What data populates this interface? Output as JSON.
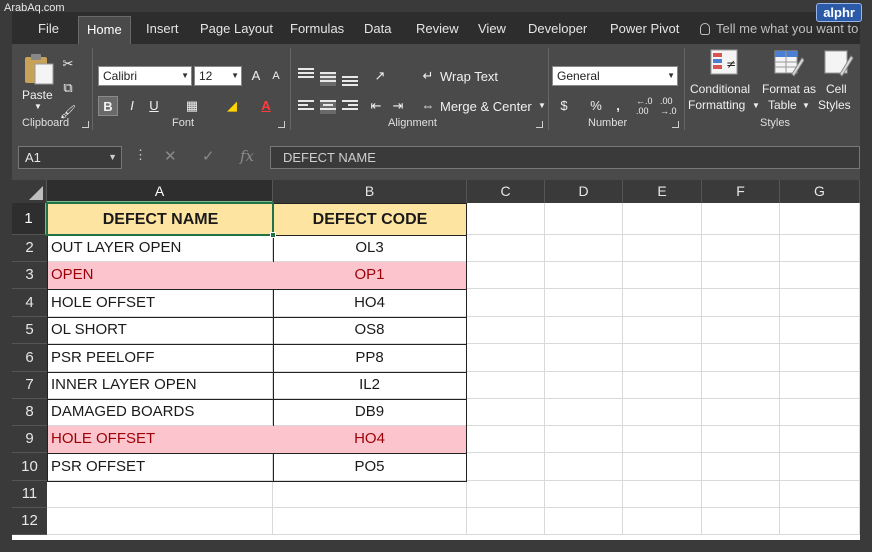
{
  "watermark": "ArabAq.com",
  "badge": "alphr",
  "tabs": [
    "File",
    "Home",
    "Insert",
    "Page Layout",
    "Formulas",
    "Data",
    "Review",
    "View",
    "Developer",
    "Power Pivot"
  ],
  "tell_me": "Tell me what you want to",
  "ribbon": {
    "clipboard": {
      "paste": "Paste",
      "label": "Clipboard"
    },
    "font": {
      "name": "Calibri",
      "size": "12",
      "grow": "A",
      "shrink": "A",
      "bold": "B",
      "italic": "I",
      "underline": "U",
      "label": "Font"
    },
    "alignment": {
      "wrap": "Wrap Text",
      "merge": "Merge & Center",
      "label": "Alignment"
    },
    "number": {
      "format": "General",
      "currency": "$",
      "percent": "%",
      "comma": ",",
      "inc_dec": ".00",
      "dec_dec": ".00",
      "inc_sub": "←.0",
      "dec_sub": "→.0",
      "label": "Number"
    },
    "styles": {
      "conditional_1": "Conditional",
      "conditional_2": "Formatting",
      "format_table_1": "Format as",
      "format_table_2": "Table",
      "cell_1": "Cell",
      "cell_2": "Styles",
      "label": "Styles"
    }
  },
  "formula_bar": {
    "name_box": "A1",
    "cancel": "✕",
    "enter": "✓",
    "fx": "fx",
    "content": "DEFECT NAME"
  },
  "columns": [
    "A",
    "B",
    "C",
    "D",
    "E",
    "F",
    "G"
  ],
  "rows": [
    "1",
    "2",
    "3",
    "4",
    "5",
    "6",
    "7",
    "8",
    "9",
    "10",
    "11",
    "12"
  ],
  "table": {
    "headers": [
      "DEFECT NAME",
      "DEFECT CODE"
    ],
    "rows": [
      [
        "OUT LAYER OPEN",
        "OL3"
      ],
      [
        "OPEN",
        "OP1"
      ],
      [
        "HOLE OFFSET",
        "HO4"
      ],
      [
        "OL SHORT",
        "OS8"
      ],
      [
        "PSR PEELOFF",
        "PP8"
      ],
      [
        "INNER LAYER OPEN",
        "IL2"
      ],
      [
        "DAMAGED BOARDS",
        "DB9"
      ],
      [
        "HOLE OFFSET",
        "HO4"
      ],
      [
        "PSR OFFSET",
        "PO5"
      ]
    ],
    "duplicate_highlight_rows": [
      3,
      9
    ],
    "colors": {
      "header_fill": "#fde5a1",
      "duplicate_fill": "#fcc5ce",
      "duplicate_text": "#9c0006",
      "accent": "#217346"
    }
  }
}
